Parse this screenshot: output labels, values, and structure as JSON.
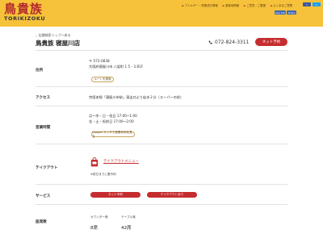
{
  "header": {
    "logo_kanji": "鳥貴族",
    "logo_roman": "TORIKIZOKU",
    "links": [
      "アレルギー・栄養成分情報",
      "原産地情報",
      "ご意見・ご要望",
      "よくあるご質問"
    ],
    "buttons": [
      "f",
      "t"
    ],
    "like": "Like 15K",
    "share": "Share"
  },
  "breadcrumb": {
    "back": "店舗検索トップへ戻る"
  },
  "store": {
    "name": "鳥貴族 寝屋川店",
    "phone": "072-824-3311",
    "reserve_label": "ネット予約"
  },
  "rows": {
    "address": {
      "label": "住所",
      "zip": "〒 572-0838",
      "line": "大阪府寝屋川市 八坂町 1 5 - 3 B1F",
      "route_button": "ルートを検索"
    },
    "access": {
      "label": "アクセス",
      "text": "京阪本線「寝屋川市駅」東出口より徒歩２分（スーパーの前）"
    },
    "hours": {
      "label": "営業時間",
      "line1": "月～木・日・祝日 17:00~1:00",
      "line2": "金・土・祝前日 17:00~2:00",
      "maps_button": "Google マップで営業状況を見る"
    },
    "takeout": {
      "label": "テイクアウト",
      "link": "テイクアウトメニュー",
      "note": "※前日までに要予約"
    },
    "services": {
      "label": "サービス",
      "tags": [
        "ネット予約",
        "テイクアウトあり"
      ]
    },
    "seats": {
      "label": "座席数",
      "counter_label": "カウンター席",
      "counter_value": "8席",
      "table_label": "テーブル席",
      "table_value": "42席"
    }
  },
  "colors": {
    "header_yellow": "#f6c23a",
    "brand_red": "#c52d2f",
    "logo_red": "#b3282d"
  }
}
